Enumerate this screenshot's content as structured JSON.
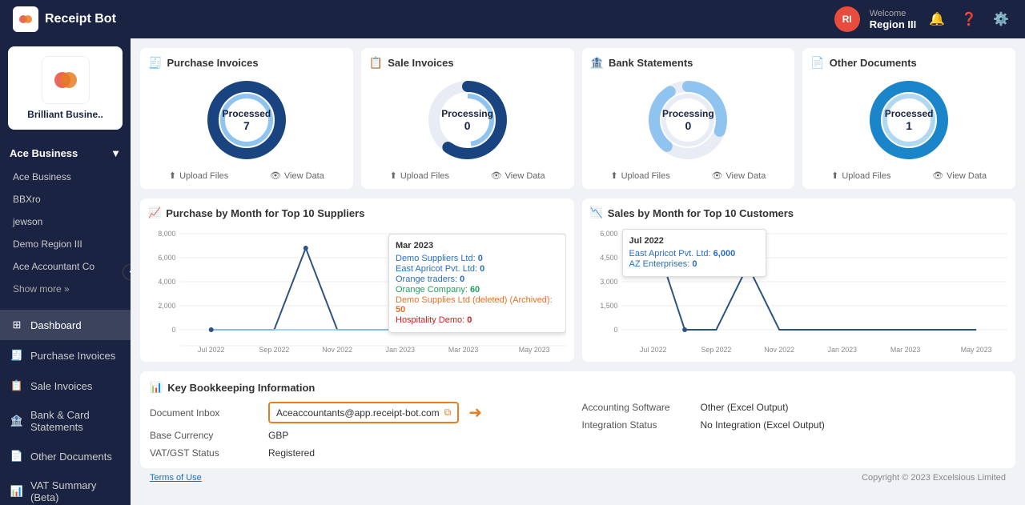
{
  "header": {
    "logo_text": "Receipt Bot",
    "avatar_initials": "RI",
    "welcome_label": "Welcome",
    "user_name": "Region III"
  },
  "sidebar": {
    "company_name": "Brilliant Busine..",
    "group_label": "Ace Business",
    "subitems": [
      "Ace Business",
      "BBXro",
      "jewson",
      "Demo Region III",
      "Ace Accountant Co"
    ],
    "show_more": "Show more »",
    "nav_items": [
      {
        "label": "Dashboard",
        "icon": "dashboard"
      },
      {
        "label": "Purchase Invoices",
        "icon": "purchase"
      },
      {
        "label": "Sale Invoices",
        "icon": "sale"
      },
      {
        "label": "Bank & Card Statements",
        "icon": "bank"
      },
      {
        "label": "Other Documents",
        "icon": "doc"
      },
      {
        "label": "VAT Summary (Beta)",
        "icon": "vat"
      }
    ]
  },
  "cards": [
    {
      "title": "Purchase Invoices",
      "status": "Processed",
      "count": "7",
      "upload_label": "Upload Files",
      "view_label": "View Data",
      "processed_pct": 100,
      "color_main": "#1a4480",
      "color_light": "#90c4f0"
    },
    {
      "title": "Sale Invoices",
      "status": "Processing",
      "count": "0",
      "upload_label": "Upload Files",
      "view_label": "View Data",
      "processed_pct": 60,
      "color_main": "#1a4480",
      "color_light": "#90c4f0"
    },
    {
      "title": "Bank Statements",
      "status": "Processing",
      "count": "0",
      "upload_label": "Upload Files",
      "view_label": "View Data",
      "processed_pct": 30,
      "color_main": "#1a4480",
      "color_light": "#90c4f0"
    },
    {
      "title": "Other Documents",
      "status": "Processed",
      "count": "1",
      "upload_label": "Upload Files",
      "view_label": "View Data",
      "processed_pct": 100,
      "color_main": "#1a85c8",
      "color_light": "#b0d8f0"
    }
  ],
  "purchase_chart": {
    "title": "Purchase by Month for Top 10 Suppliers",
    "tooltip": {
      "title": "Mar 2023",
      "items": [
        {
          "label": "Demo Suppliers Ltd:",
          "value": "0",
          "color": "#2a6ebb"
        },
        {
          "label": "East Apricot Pvt. Ltd:",
          "value": "0",
          "color": "#2a6ebb"
        },
        {
          "label": "Orange traders:",
          "value": "0",
          "color": "#2a6ebb"
        },
        {
          "label": "Orange Company:",
          "value": "60",
          "color": "#20a060"
        },
        {
          "label": "Demo Supplies Ltd (deleted) (Archived):",
          "value": "50",
          "color": "#e87020"
        },
        {
          "label": "Hospitality Demo:",
          "value": "0",
          "color": "#cc2020"
        }
      ]
    }
  },
  "sales_chart": {
    "title": "Sales by Month for Top 10 Customers",
    "tooltip": {
      "title": "Jul 2022",
      "items": [
        {
          "label": "East Apricot Pvt. Ltd:",
          "value": "6,000",
          "color": "#2a6ebb"
        },
        {
          "label": "AZ Enterprises:",
          "value": "0",
          "color": "#2a6ebb"
        }
      ]
    }
  },
  "bookkeeping": {
    "title": "Key Bookkeeping Information",
    "rows_left": [
      {
        "label": "Document Inbox",
        "value": "Aceaccountants@app.receipt-bot.com"
      },
      {
        "label": "Base Currency",
        "value": "GBP"
      },
      {
        "label": "VAT/GST Status",
        "value": "Registered"
      }
    ],
    "rows_right": [
      {
        "label": "Accounting Software",
        "value": "Other (Excel Output)"
      },
      {
        "label": "Integration Status",
        "value": "No Integration (Excel Output)"
      }
    ]
  },
  "footer": {
    "terms_label": "Terms of Use",
    "copyright": "Copyright © 2023 Excelsious Limited"
  }
}
